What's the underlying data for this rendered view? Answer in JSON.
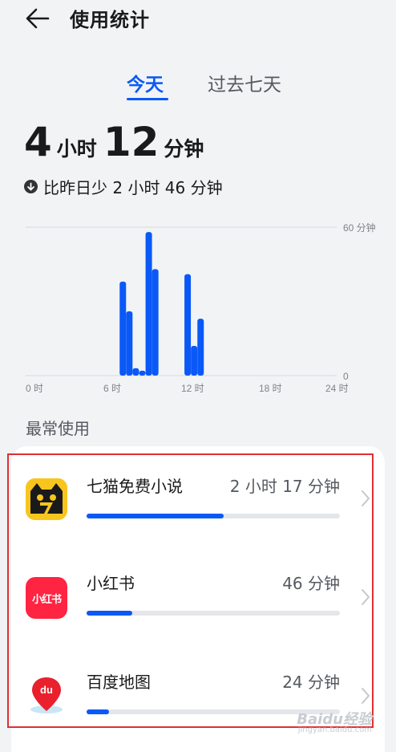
{
  "header": {
    "title": "使用统计",
    "back_icon": "arrow-left-icon"
  },
  "tabs": [
    {
      "label": "今天",
      "active": true
    },
    {
      "label": "过去七天",
      "active": false
    }
  ],
  "summary": {
    "hours": "4",
    "hours_unit": "小时",
    "minutes": "12",
    "minutes_unit": "分钟",
    "comparison": "比昨日少 2 小时 46 分钟"
  },
  "chart_data": {
    "type": "bar",
    "x_tick_labels": [
      "0 时",
      "6 时",
      "12 时",
      "18 时",
      "24 时"
    ],
    "y_tick_labels": [
      "60 分钟",
      "0"
    ],
    "ylim": [
      0,
      60
    ],
    "xlim": [
      0,
      24
    ],
    "x": [
      6,
      6.5,
      7,
      7.5,
      8,
      8.5,
      9,
      9.5,
      10,
      10.5,
      11,
      11.5,
      12,
      12.5,
      13,
      13.5,
      14,
      14.5,
      15
    ],
    "values": [
      0,
      0,
      0,
      38,
      26,
      3,
      2,
      58,
      43,
      0,
      0,
      0,
      0,
      41,
      12,
      23,
      0,
      0,
      0
    ],
    "color": "#0a59f7"
  },
  "most_used": {
    "title": "最常使用",
    "apps": [
      {
        "name": "七猫免费小说",
        "time": "2 小时 17 分钟",
        "fraction": 0.54,
        "icon": "qimao-cat-icon"
      },
      {
        "name": "小红书",
        "time": "46 分钟",
        "fraction": 0.18,
        "icon": "xiaohongshu-icon",
        "icon_text": "小红书"
      },
      {
        "name": "百度地图",
        "time": "24 分钟",
        "fraction": 0.09,
        "icon": "baidu-map-pin-icon",
        "icon_text": "du"
      }
    ]
  },
  "watermark": {
    "text": "Baidu经验",
    "sub": "jingyan.baidu.com"
  }
}
